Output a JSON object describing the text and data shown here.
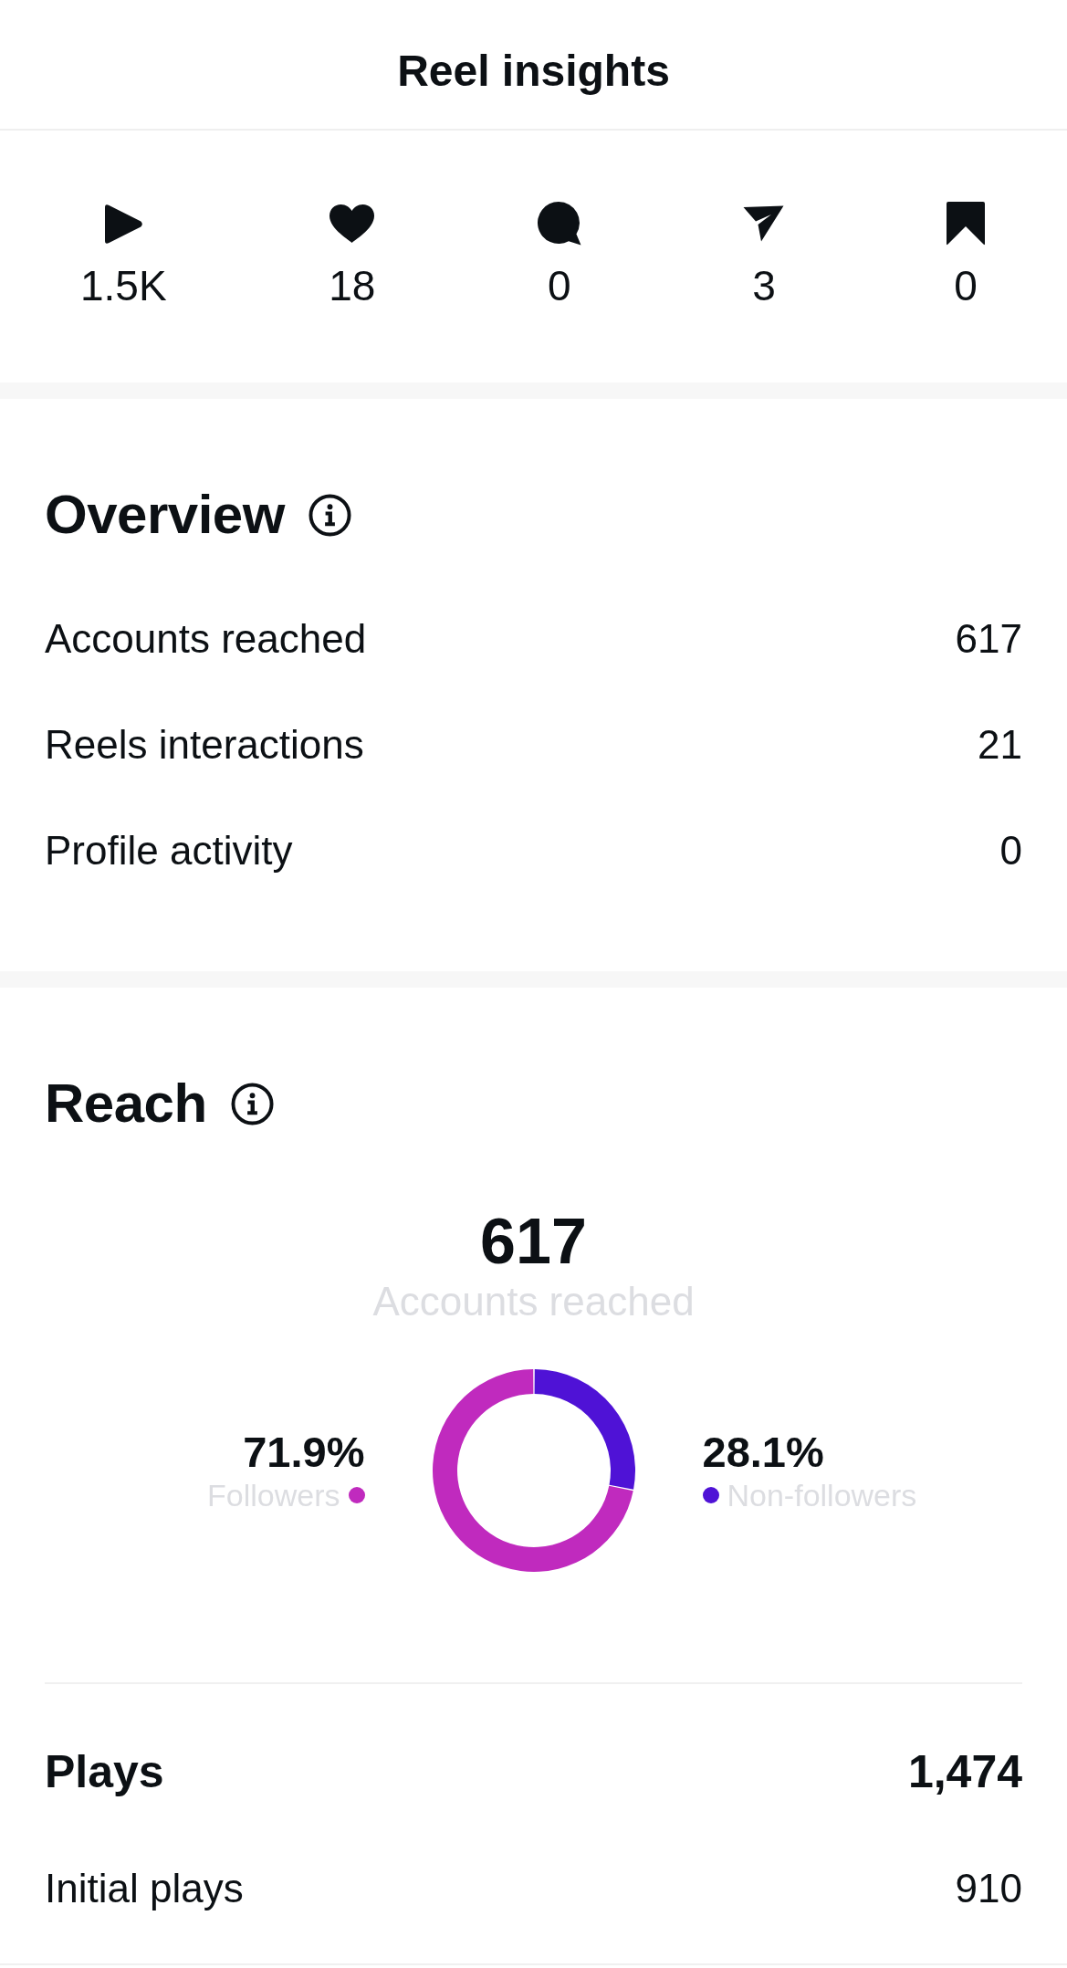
{
  "header": {
    "title": "Reel insights"
  },
  "stats": [
    {
      "kind": "plays",
      "value": "1.5K"
    },
    {
      "kind": "likes",
      "value": "18"
    },
    {
      "kind": "comments",
      "value": "0"
    },
    {
      "kind": "shares",
      "value": "3"
    },
    {
      "kind": "saves",
      "value": "0"
    }
  ],
  "overview": {
    "title": "Overview",
    "rows": [
      {
        "label": "Accounts reached",
        "value": "617"
      },
      {
        "label": "Reels interactions",
        "value": "21"
      },
      {
        "label": "Profile activity",
        "value": "0"
      }
    ]
  },
  "reach": {
    "title": "Reach",
    "total": "617",
    "total_label": "Accounts reached",
    "chart_data": {
      "type": "donut",
      "categories": [
        "Followers",
        "Non-followers"
      ],
      "values": [
        71.9,
        28.1
      ],
      "value_labels": [
        "71.9%",
        "28.1%"
      ]
    },
    "legend": [
      {
        "color": "#c02abe"
      },
      {
        "color": "#4f12d6"
      }
    ]
  },
  "plays": {
    "label": "Plays",
    "value": "1,474",
    "rows": [
      {
        "label": "Initial plays",
        "value": "910"
      }
    ]
  }
}
